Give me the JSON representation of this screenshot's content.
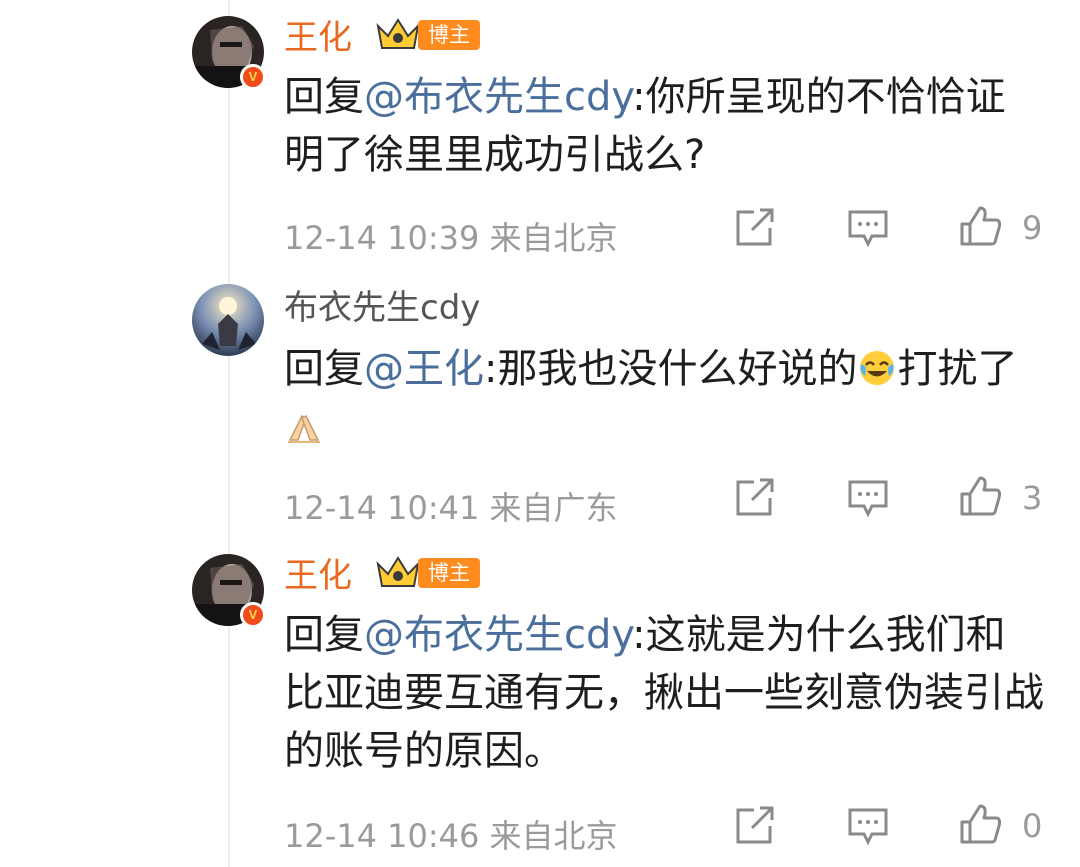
{
  "comments": [
    {
      "author": "王化",
      "badge": "博主",
      "reply_prefix": "回复",
      "mention": "@布衣先生cdy",
      "text": ":你所呈现的不恰恰证明了徐里里成功引战么?",
      "time": "12-14 10:39",
      "location": "来自北京",
      "likes": "9"
    },
    {
      "author": "布衣先生cdy",
      "reply_prefix": "回复",
      "mention": "@王化",
      "text": ":那我也没什么好说的",
      "text2": "打扰了",
      "emoji1": "crying-laughing-emoji",
      "emoji2": "pleading-hands-emoji",
      "time": "12-14 10:41",
      "location": "来自广东",
      "likes": "3"
    },
    {
      "author": "王化",
      "badge": "博主",
      "reply_prefix": "回复",
      "mention": "@布衣先生cdy",
      "text": ":这就是为什么我们和比亚迪要互通有无，揪出一些刻意伪装引战的账号的原因。",
      "time": "12-14 10:46",
      "location": "来自北京",
      "likes": "0"
    }
  ],
  "icons": {
    "verified": "v-verified-icon",
    "crown": "crown-icon",
    "repost": "repost-icon",
    "comment": "comment-icon",
    "like": "thumbs-up-icon"
  },
  "colors": {
    "vip_name": "#e8691f",
    "mention": "#4a6f9c",
    "meta": "#9a9a9a",
    "badge_bg": "#ff8a1d"
  }
}
